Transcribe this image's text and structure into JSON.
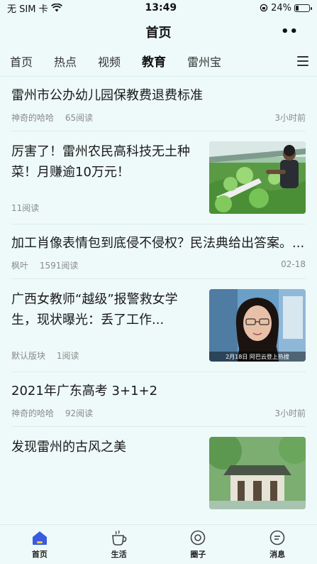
{
  "status": {
    "carrier": "无 SIM 卡",
    "time": "13:49",
    "battery": "24%",
    "battery_level": 0.24
  },
  "header": {
    "title": "首页",
    "more_label": "••"
  },
  "tabs": [
    {
      "label": "首页",
      "active": false
    },
    {
      "label": "热点",
      "active": false
    },
    {
      "label": "视频",
      "active": false
    },
    {
      "label": "教育",
      "active": true
    },
    {
      "label": "雷州宝",
      "active": false
    }
  ],
  "feed": [
    {
      "title": "雷州市公办幼儿园保教费退费标准",
      "author": "神奇的哈哈",
      "reads": "65阅读",
      "time": "3小时前"
    },
    {
      "title": "厉害了！雷州农民高科技无土种菜！月赚逾10万元！",
      "author": "",
      "reads": "11阅读",
      "time": ""
    },
    {
      "title": "加工肖像表情包到底侵不侵权？民法典给出答案。...",
      "author": "枫叶",
      "reads": "1591阅读",
      "time": "02-18"
    },
    {
      "title": "广西女教师“越级”报警救女学生，现状曝光：丢了工作...",
      "author": "默认版块",
      "reads": "1阅读",
      "time": "",
      "image_caption": "2月18日 阿巴云登上热搜"
    },
    {
      "title": "2021年广东高考 3+1+2",
      "author": "神奇的哈哈",
      "reads": "92阅读",
      "time": "3小时前"
    },
    {
      "title": "发现雷州的古风之美",
      "author": "",
      "reads": "",
      "time": ""
    }
  ],
  "tabbar": [
    {
      "label": "首页",
      "icon": "home-icon"
    },
    {
      "label": "生活",
      "icon": "cup-icon"
    },
    {
      "label": "圈子",
      "icon": "circle-icon"
    },
    {
      "label": "消息",
      "icon": "message-icon"
    }
  ],
  "colors": {
    "background": "#eefaf9",
    "accent": "#3a5ae0",
    "meta_text": "#8a8a8a"
  }
}
